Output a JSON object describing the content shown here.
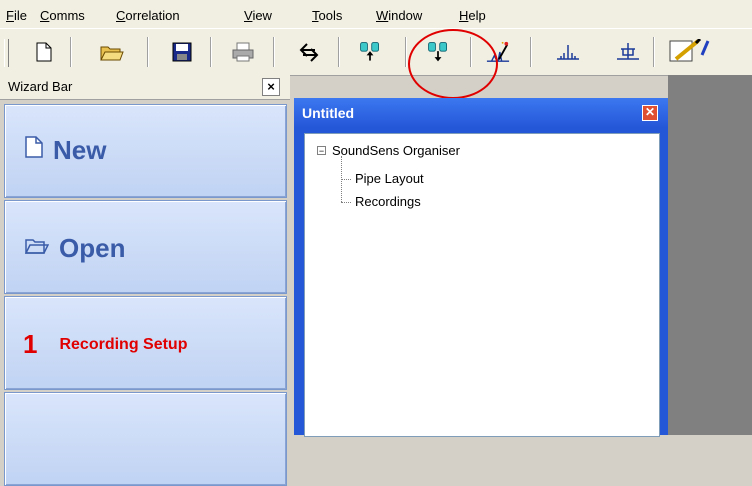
{
  "menu": {
    "items": [
      {
        "accel": "F",
        "rest": "ile"
      },
      {
        "accel": "C",
        "rest": "omms"
      },
      {
        "accel": "C",
        "rest": "orrelation"
      },
      {
        "accel": "V",
        "rest": "iew"
      },
      {
        "accel": "T",
        "rest": "ools"
      },
      {
        "accel": "W",
        "rest": "indow"
      },
      {
        "accel": "H",
        "rest": "elp"
      }
    ]
  },
  "toolbar": {
    "buttons": [
      "new-document",
      "open-folder",
      "save-disk",
      "print",
      "comms-transfer",
      "upload-to-logger",
      "download-from-logger",
      "correlation-wizard",
      "spectrum",
      "filter"
    ]
  },
  "wizard": {
    "title": "Wizard Bar",
    "close_label": "×",
    "new_label": "New",
    "open_label": "Open",
    "step_number": "1",
    "recording_setup_label": "Recording Setup"
  },
  "document": {
    "title": "Untitled",
    "tree": {
      "root": "SoundSens Organiser",
      "children": [
        "Pipe Layout",
        "Recordings"
      ]
    }
  },
  "colors": {
    "highlight_circle": "#e00000",
    "title_bar": "#2456d8",
    "wizard_text": "#3a5ca8",
    "step_red": "#e00000"
  }
}
